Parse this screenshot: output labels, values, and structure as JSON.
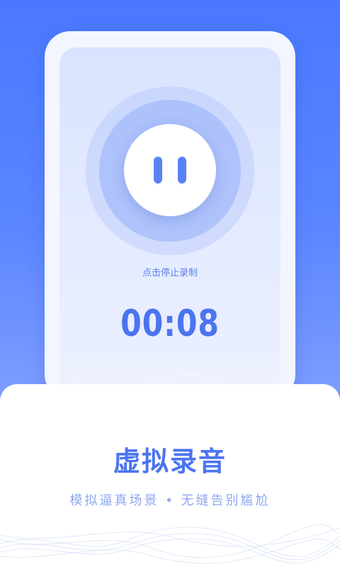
{
  "recorder": {
    "hint": "点击停止录制",
    "timer": "00:08"
  },
  "feature": {
    "title": "虚拟录音",
    "subtitle": "模拟逼真场景 • 无缝告别尴尬"
  },
  "icons": {
    "stop_button": "pause-icon"
  },
  "colors": {
    "accent": "#4b74f0",
    "background_top": "#4a78ff",
    "subtitle": "#8fa8f0"
  }
}
